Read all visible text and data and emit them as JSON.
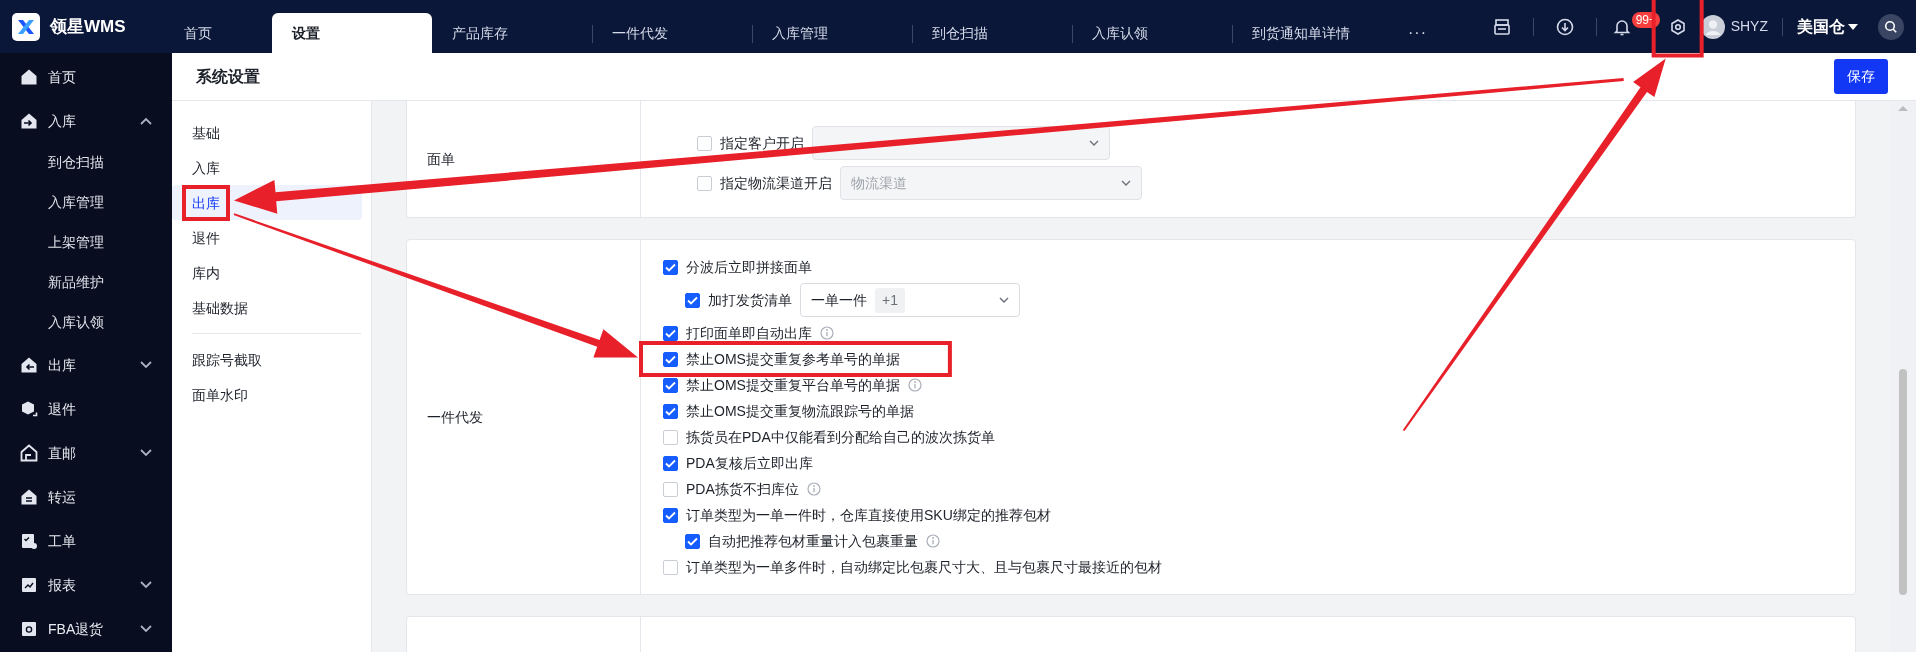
{
  "app": {
    "logo_text": "领星WMS"
  },
  "top_tabs": [
    {
      "label": "首页",
      "selected": false
    },
    {
      "label": "设置",
      "selected": true
    },
    {
      "label": "产品库存",
      "selected": false
    },
    {
      "label": "一件代发",
      "selected": false
    },
    {
      "label": "入库管理",
      "selected": false
    },
    {
      "label": "到仓扫描",
      "selected": false
    },
    {
      "label": "入库认领",
      "selected": false
    },
    {
      "label": "到货通知单详情",
      "selected": false
    }
  ],
  "more_tabs": "···",
  "toolbar": [
    {
      "kind": "printer"
    },
    {
      "kind": "download"
    },
    {
      "kind": "bell",
      "badge": "99+"
    },
    {
      "kind": "settings",
      "highlighted": true
    }
  ],
  "user": {
    "name": "SHYZ"
  },
  "warehouse": {
    "label": "美国仓"
  },
  "sidebar": [
    {
      "label": "首页",
      "kind": "home"
    },
    {
      "label": "入库",
      "kind": "inbound",
      "expanded": true,
      "children": [
        {
          "label": "到仓扫描"
        },
        {
          "label": "入库管理"
        },
        {
          "label": "上架管理"
        },
        {
          "label": "新品维护"
        },
        {
          "label": "入库认领"
        }
      ]
    },
    {
      "label": "出库",
      "kind": "outbound",
      "expanded": false
    },
    {
      "label": "退件",
      "kind": "returns"
    },
    {
      "label": "直邮",
      "kind": "direct",
      "expanded": false
    },
    {
      "label": "转运",
      "kind": "transfer"
    },
    {
      "label": "工单",
      "kind": "ticket"
    },
    {
      "label": "报表",
      "kind": "report",
      "expanded": false
    },
    {
      "label": "FBA退货",
      "kind": "fba",
      "expanded": false
    }
  ],
  "page": {
    "title": "系统设置",
    "save_button": "保存"
  },
  "settings_nav_groups": [
    {
      "items": [
        {
          "label": "基础",
          "selected": false
        },
        {
          "label": "入库",
          "selected": false
        },
        {
          "label": "出库",
          "selected": true,
          "highlighted": true
        },
        {
          "label": "退件",
          "selected": false
        },
        {
          "label": "库内",
          "selected": false
        },
        {
          "label": "基础数据",
          "selected": false
        }
      ]
    },
    {
      "items": [
        {
          "label": "跟踪号截取",
          "selected": false
        },
        {
          "label": "面单水印",
          "selected": false
        }
      ]
    }
  ],
  "sections": [
    {
      "title": "面单",
      "cut_top": true,
      "rows": [
        {
          "label": "指定客户开启",
          "checked": false,
          "select": {}
        },
        {
          "label": "指定物流渠道开启",
          "checked": false,
          "select": {
            "placeholder": "物流渠道"
          }
        }
      ]
    },
    {
      "title": "一件代发",
      "rows": [
        {
          "label": "分波后立即拼接面单",
          "checked": true,
          "children": [
            {
              "label": "加打发货清单",
              "checked": true,
              "select": {
                "values": [
                  "一单一件"
                ],
                "more": "+1"
              }
            }
          ]
        },
        {
          "label": "打印面单即自动出库",
          "checked": true,
          "info": true
        },
        {
          "label": "禁止OMS提交重复参考单号的单据",
          "checked": true,
          "highlighted": true
        },
        {
          "label": "禁止OMS提交重复平台单号的单据",
          "checked": true,
          "info": true
        },
        {
          "label": "禁止OMS提交重复物流跟踪号的单据",
          "checked": true
        },
        {
          "label": "拣货员在PDA中仅能看到分配给自己的波次拣货单",
          "checked": false
        },
        {
          "label": "PDA复核后立即出库",
          "checked": true
        },
        {
          "label": "PDA拣货不扫库位",
          "checked": false,
          "info": true
        },
        {
          "label": "订单类型为一单一件时，仓库直接使用SKU绑定的推荐包材",
          "checked": true,
          "children": [
            {
              "label": "自动把推荐包材重量计入包裹重量",
              "checked": true,
              "info": true
            }
          ]
        },
        {
          "label": "订单类型为一单多件时，自动绑定比包裹尺寸大、且与包裹尺寸最接近的包材",
          "checked": false
        }
      ]
    },
    {
      "cut_bottom": true
    }
  ]
}
